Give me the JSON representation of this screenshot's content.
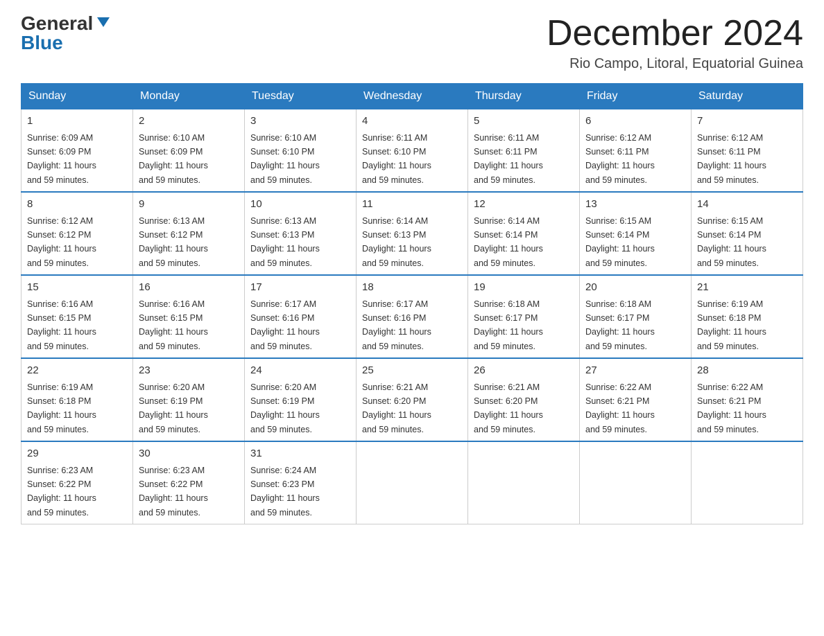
{
  "logo": {
    "general": "General",
    "blue": "Blue"
  },
  "title": "December 2024",
  "location": "Rio Campo, Litoral, Equatorial Guinea",
  "days_of_week": [
    "Sunday",
    "Monday",
    "Tuesday",
    "Wednesday",
    "Thursday",
    "Friday",
    "Saturday"
  ],
  "weeks": [
    [
      {
        "day": "1",
        "sunrise": "6:09 AM",
        "sunset": "6:09 PM",
        "daylight": "11 hours and 59 minutes."
      },
      {
        "day": "2",
        "sunrise": "6:10 AM",
        "sunset": "6:09 PM",
        "daylight": "11 hours and 59 minutes."
      },
      {
        "day": "3",
        "sunrise": "6:10 AM",
        "sunset": "6:10 PM",
        "daylight": "11 hours and 59 minutes."
      },
      {
        "day": "4",
        "sunrise": "6:11 AM",
        "sunset": "6:10 PM",
        "daylight": "11 hours and 59 minutes."
      },
      {
        "day": "5",
        "sunrise": "6:11 AM",
        "sunset": "6:11 PM",
        "daylight": "11 hours and 59 minutes."
      },
      {
        "day": "6",
        "sunrise": "6:12 AM",
        "sunset": "6:11 PM",
        "daylight": "11 hours and 59 minutes."
      },
      {
        "day": "7",
        "sunrise": "6:12 AM",
        "sunset": "6:11 PM",
        "daylight": "11 hours and 59 minutes."
      }
    ],
    [
      {
        "day": "8",
        "sunrise": "6:12 AM",
        "sunset": "6:12 PM",
        "daylight": "11 hours and 59 minutes."
      },
      {
        "day": "9",
        "sunrise": "6:13 AM",
        "sunset": "6:12 PM",
        "daylight": "11 hours and 59 minutes."
      },
      {
        "day": "10",
        "sunrise": "6:13 AM",
        "sunset": "6:13 PM",
        "daylight": "11 hours and 59 minutes."
      },
      {
        "day": "11",
        "sunrise": "6:14 AM",
        "sunset": "6:13 PM",
        "daylight": "11 hours and 59 minutes."
      },
      {
        "day": "12",
        "sunrise": "6:14 AM",
        "sunset": "6:14 PM",
        "daylight": "11 hours and 59 minutes."
      },
      {
        "day": "13",
        "sunrise": "6:15 AM",
        "sunset": "6:14 PM",
        "daylight": "11 hours and 59 minutes."
      },
      {
        "day": "14",
        "sunrise": "6:15 AM",
        "sunset": "6:14 PM",
        "daylight": "11 hours and 59 minutes."
      }
    ],
    [
      {
        "day": "15",
        "sunrise": "6:16 AM",
        "sunset": "6:15 PM",
        "daylight": "11 hours and 59 minutes."
      },
      {
        "day": "16",
        "sunrise": "6:16 AM",
        "sunset": "6:15 PM",
        "daylight": "11 hours and 59 minutes."
      },
      {
        "day": "17",
        "sunrise": "6:17 AM",
        "sunset": "6:16 PM",
        "daylight": "11 hours and 59 minutes."
      },
      {
        "day": "18",
        "sunrise": "6:17 AM",
        "sunset": "6:16 PM",
        "daylight": "11 hours and 59 minutes."
      },
      {
        "day": "19",
        "sunrise": "6:18 AM",
        "sunset": "6:17 PM",
        "daylight": "11 hours and 59 minutes."
      },
      {
        "day": "20",
        "sunrise": "6:18 AM",
        "sunset": "6:17 PM",
        "daylight": "11 hours and 59 minutes."
      },
      {
        "day": "21",
        "sunrise": "6:19 AM",
        "sunset": "6:18 PM",
        "daylight": "11 hours and 59 minutes."
      }
    ],
    [
      {
        "day": "22",
        "sunrise": "6:19 AM",
        "sunset": "6:18 PM",
        "daylight": "11 hours and 59 minutes."
      },
      {
        "day": "23",
        "sunrise": "6:20 AM",
        "sunset": "6:19 PM",
        "daylight": "11 hours and 59 minutes."
      },
      {
        "day": "24",
        "sunrise": "6:20 AM",
        "sunset": "6:19 PM",
        "daylight": "11 hours and 59 minutes."
      },
      {
        "day": "25",
        "sunrise": "6:21 AM",
        "sunset": "6:20 PM",
        "daylight": "11 hours and 59 minutes."
      },
      {
        "day": "26",
        "sunrise": "6:21 AM",
        "sunset": "6:20 PM",
        "daylight": "11 hours and 59 minutes."
      },
      {
        "day": "27",
        "sunrise": "6:22 AM",
        "sunset": "6:21 PM",
        "daylight": "11 hours and 59 minutes."
      },
      {
        "day": "28",
        "sunrise": "6:22 AM",
        "sunset": "6:21 PM",
        "daylight": "11 hours and 59 minutes."
      }
    ],
    [
      {
        "day": "29",
        "sunrise": "6:23 AM",
        "sunset": "6:22 PM",
        "daylight": "11 hours and 59 minutes."
      },
      {
        "day": "30",
        "sunrise": "6:23 AM",
        "sunset": "6:22 PM",
        "daylight": "11 hours and 59 minutes."
      },
      {
        "day": "31",
        "sunrise": "6:24 AM",
        "sunset": "6:23 PM",
        "daylight": "11 hours and 59 minutes."
      },
      null,
      null,
      null,
      null
    ]
  ],
  "sunrise_label": "Sunrise:",
  "sunset_label": "Sunset:",
  "daylight_label": "Daylight: 11 hours"
}
